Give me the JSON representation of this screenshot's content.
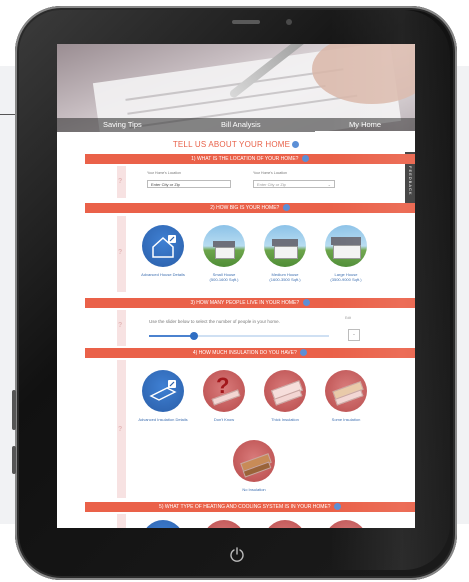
{
  "nav": {
    "items": [
      "Saving Tips",
      "Bill Analysis",
      "My Home"
    ],
    "active": "My Home"
  },
  "page": {
    "title": "TELL US ABOUT YOUR HOME"
  },
  "feedback": {
    "label": "FEEDBACK"
  },
  "q1": {
    "label": "1) WHAT IS THE LOCATION OF YOUR HOME?",
    "location_label": "Your Home's Location",
    "location_placeholder": "Enter City or Zip",
    "location2_label": "Your Home's Location",
    "location2_value": "Enter City or Zip"
  },
  "q2": {
    "label": "2) HOW BIG IS YOUR HOME?",
    "options": [
      {
        "line1": "Advanced House Details",
        "line2": ""
      },
      {
        "line1": "Small House",
        "line2": "(500-1600 Sqft.)"
      },
      {
        "line1": "Medium House",
        "line2": "(1600-3500 Sqft.)"
      },
      {
        "line1": "Large House",
        "line2": "(3500-9000 Sqft.)"
      }
    ]
  },
  "q3": {
    "label": "3) HOW MANY PEOPLE LIVE IN YOUR HOME?",
    "slider_text": "Use the slider below to select the number of people in your home.",
    "slider_value_fraction": 0.25,
    "count_label": "Edit",
    "count_value": "-"
  },
  "q4": {
    "label": "4) HOW MUCH INSULATION DO YOU HAVE?",
    "options": [
      "Advanced Insulation Details",
      "Don't Know",
      "Thick Insulation",
      "Some Insulation",
      "No Insulation"
    ]
  },
  "q5": {
    "label": "5) WHAT TYPE OF HEATING AND COOLING SYSTEM IS IN YOUR HOME?"
  },
  "question_mark": "?",
  "colors": {
    "accent": "#ea6149",
    "link_blue": "#3e6fb0",
    "bezel": "#1b1b1b"
  },
  "icons": [
    "power-icon",
    "info-icon",
    "pencil-icon",
    "question-mark-icon"
  ]
}
